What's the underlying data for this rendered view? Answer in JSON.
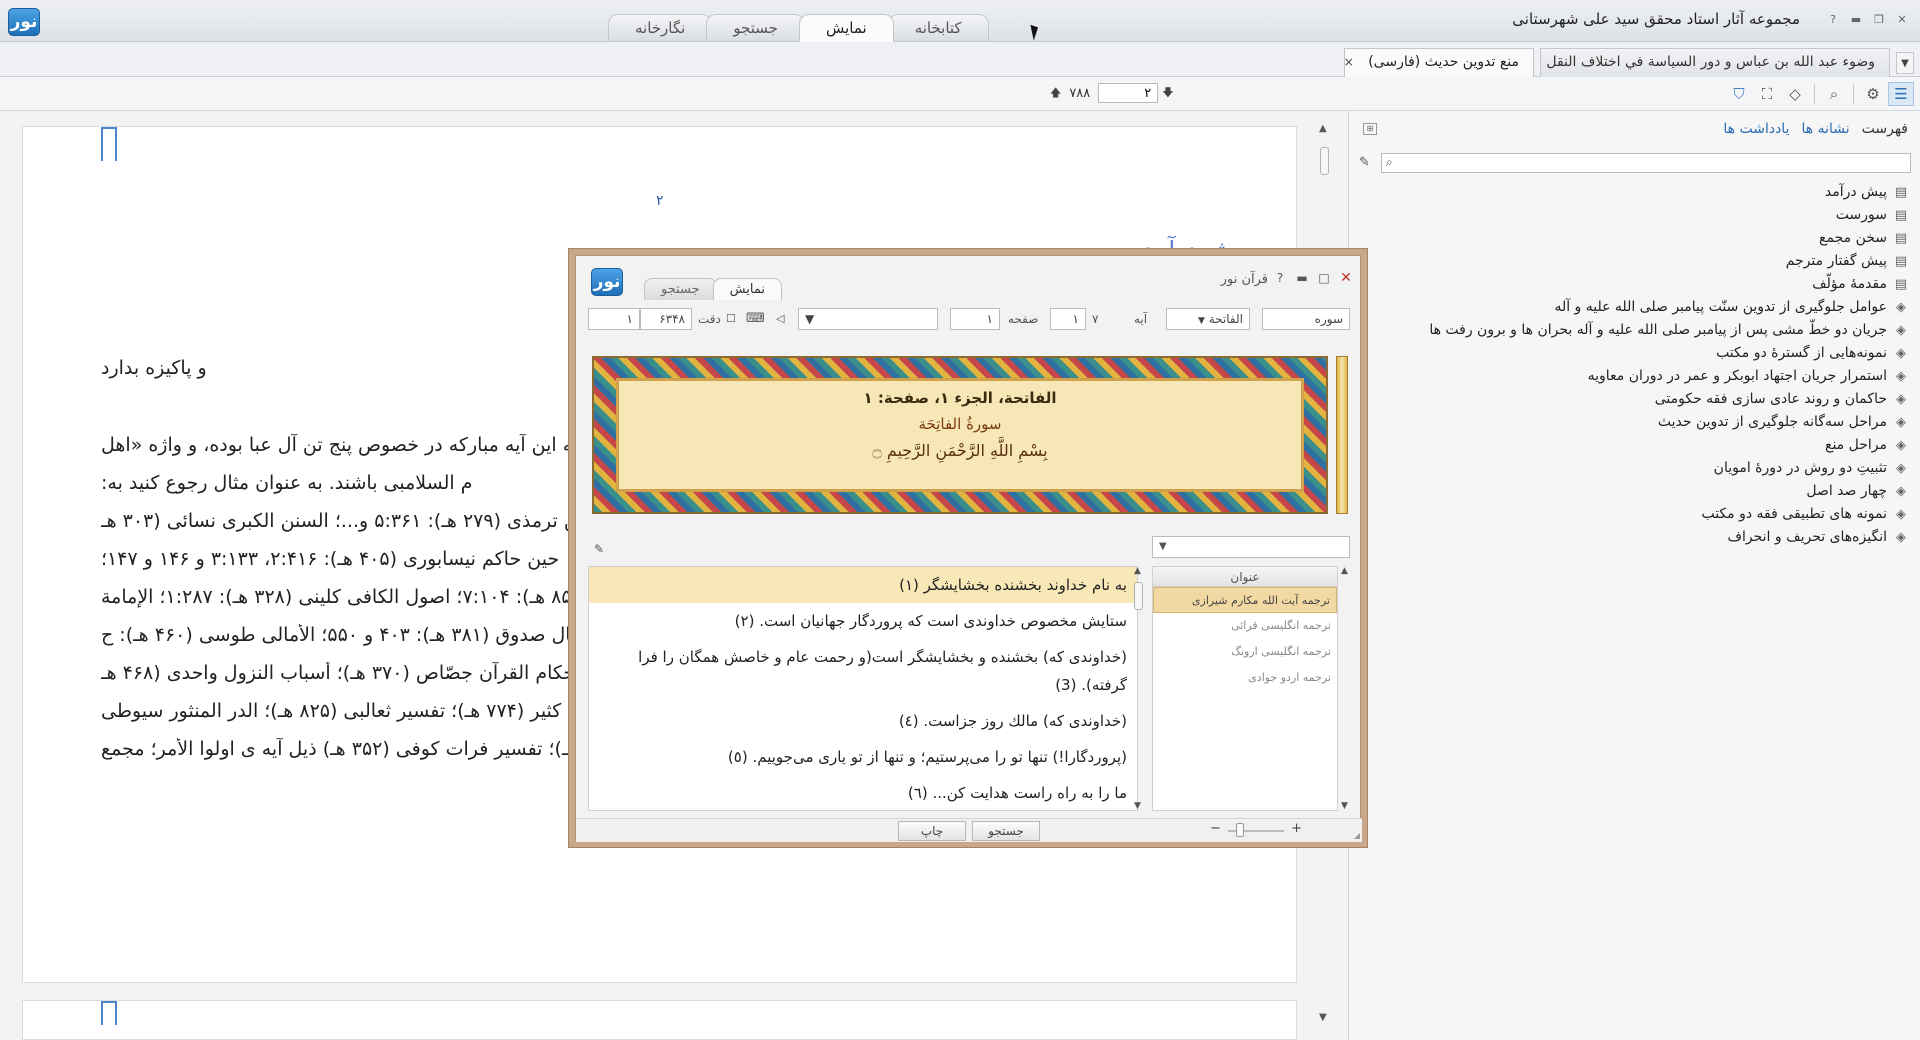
{
  "app": {
    "title": "مجموعه آثار استاد محقق سید علی شهرستانی",
    "logo_text": "نور",
    "main_tabs": [
      "کتابخانه",
      "نمایش",
      "جستجو",
      "نگارخانه"
    ],
    "active_main_tab": "نمایش"
  },
  "doc_tabs": {
    "tab1": "وضوء عبد الله بن عباس و دور السياسة في اختلاف النقل عنه",
    "tab2": "منع تدوين حديث (فارسی)",
    "close_symbol": "×"
  },
  "page_nav": {
    "total": "۷۸۸",
    "current": "۲"
  },
  "document": {
    "page_number": "۲",
    "heading": "پیش درآمد",
    "lines": [
      "و پاکیزه بدارد",
      "که این آیه مبارکه در خصوص پنج تن آل عبا بوده، و واژه «اهل",
      "م السلامبی باشند. به عنوان مثال رجوع کنید به:",
      "سنن ترمذی (۲۷۹ هـ): ۵:۳۶۱ و...؛ السنن الكبرى نسائی (۳۰۳ هـ",
      "حین حاکم نیسابوری (۴۰۵ هـ): ۲:۴۱۶، ۳:۱۳۳ و ۱۴۶ و ۱۴۷؛",
      "۸۵ هـ): ۷:۱۰۴؛ اصول الكافی كلینی (۳۲۸ هـ): ۱:۲۸۷؛ الإمامة",
      "مال صدوق (۳۸۱ هـ): ۴۰۳ و ۵۵۰؛ الأمالی طوسی (۴۶۰ هـ): ح",
      "أحكام القرآن جصّاص (۳۷۰ هـ)؛ أسباب النزول واحدی (۴۶۸ هـ",
      "كثیر (۷۷۴ هـ)؛ تفسیر ثعالبی (۸۲۵ هـ)؛ الدر المنثور سیوطی",
      "هـ)؛ تفسیر فرات كوفی (۳۵۲ هـ) ذیل آیه ی اولوا الأمر؛ مجمع"
    ]
  },
  "panel": {
    "tabs": [
      "فهرست",
      "نشانه ها",
      "یادداشت ها"
    ],
    "active_tab": "فهرست",
    "search_placeholder": "",
    "toc": [
      {
        "label": "پیش درآمد",
        "icon": "page-icon"
      },
      {
        "label": "سورست",
        "icon": "page-icon"
      },
      {
        "label": "سخن مجمع",
        "icon": "page-icon"
      },
      {
        "label": "پیش گفتار مترجم",
        "icon": "page-icon"
      },
      {
        "label": "مقدمهٔ مؤلّف",
        "icon": "page-icon"
      },
      {
        "label": "عوامل جلوگیری از تدوین سنّت پیامبر صلی الله علیه و آله",
        "icon": "chapter-icon"
      },
      {
        "label": "جریان دو خطّ مشی پس از پیامبر صلی الله علیه و آله بحران ها و برون رفت ها",
        "icon": "chapter-icon"
      },
      {
        "label": "نمونه‌هایی از گسترهٔ دو مکتب",
        "icon": "chapter-icon"
      },
      {
        "label": "استمرار جریان اجتهاد ابوبکر و عمر در دوران معاویه",
        "icon": "chapter-icon"
      },
      {
        "label": "حاکمان و روند عادی سازی فقه حکومتی",
        "icon": "chapter-icon"
      },
      {
        "label": "مراحل سه‌گانه جلوگیری از تدوین حدیث",
        "icon": "chapter-icon"
      },
      {
        "label": "مراحل منع",
        "icon": "chapter-icon"
      },
      {
        "label": "تثبیتِ دو روش در دورهٔ امویان",
        "icon": "chapter-icon"
      },
      {
        "label": "چهار صد اصل",
        "icon": "chapter-icon"
      },
      {
        "label": "نمونه های تطبیقی فقه دو مکتب",
        "icon": "chapter-icon"
      },
      {
        "label": "انگیزه‌های تحریف و انحراف",
        "icon": "chapter-icon"
      }
    ]
  },
  "dialog": {
    "title": "قرآن نور",
    "tabs": [
      "جستجو",
      "نمایش"
    ],
    "active_tab": "نمایش",
    "fields": {
      "sura_label": "سوره",
      "sura_value": "الفاتحة",
      "aya_label": "آیه",
      "aya_value": "۱",
      "aya_total": "۷",
      "page_label": "صفحه",
      "page_value": "۱",
      "total_verses": "۶۳۴۸",
      "verse_index": "۱",
      "exact_label": "دقت"
    },
    "header": {
      "line1": "الفاتحة، الجزء ۱، صفحة: ۱",
      "line2": "سورةُ الفاتِحَة",
      "line3": "بِسْمِ اللَّهِ الرَّحْمَنِ الرَّحِيمِ ۝"
    },
    "verses": [
      "به نام خداوند بخشنده بخشایشگر (۱)",
      "ستایش مخصوص خداوندی است که پروردگار جهانیان است. (۲)",
      "(خداوندی که) بخشنده و بخشایشگر است(و رحمت عام و خاصش همگان را فرا گرفته). (3)",
      "(خداوندی که) مالك روز جزاست. (٤)",
      "(پروردگارا!) تنها تو را می‌پرستیم؛ و تنها از تو یاری می‌جوییم. (٥)",
      "ما را به راه راست هدایت کن... (٦)"
    ],
    "translations_header": "عنوان",
    "translations": [
      "ترجمه آیت الله مکارم شیرازی",
      "ترجمه انگلیسی قرائی",
      "ترجمه انگلیسی ارونگ",
      "ترجمه اردو جوادی"
    ],
    "search_button": "جستجو",
    "print_button": "چاپ",
    "zoom_minus": "−",
    "zoom_plus": "+"
  }
}
